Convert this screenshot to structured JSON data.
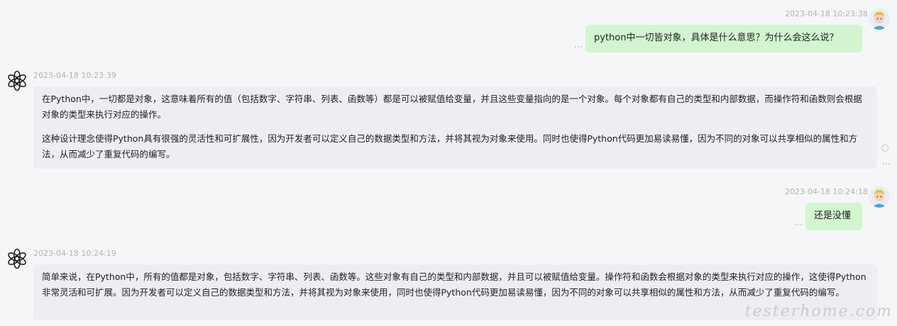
{
  "messages": [
    {
      "role": "user",
      "timestamp": "2023-04-18 10:23:38",
      "text": "python中一切皆对象，具体是什么意思？为什么会这么说？"
    },
    {
      "role": "assistant",
      "timestamp": "2023-04-18 10:23:39",
      "paragraphs": [
        "在Python中，一切都是对象，这意味着所有的值（包括数字、字符串、列表、函数等）都是可以被赋值给变量，并且这些变量指向的是一个对象。每个对象都有自己的类型和内部数据，而操作符和函数则会根据对象的类型来执行对应的操作。",
        "这种设计理念使得Python具有很强的灵活性和可扩展性，因为开发者可以定义自己的数据类型和方法，并将其视为对象来使用。同时也使得Python代码更加易读易懂，因为不同的对象可以共享相似的属性和方法，从而减少了重复代码的编写。"
      ]
    },
    {
      "role": "user",
      "timestamp": "2023-04-18 10:24:18",
      "text": "还是没懂"
    },
    {
      "role": "assistant",
      "timestamp": "2023-04-18 10:24:19",
      "paragraphs": [
        "简单来说，在Python中，所有的值都是对象，包括数字、字符串、列表、函数等。这些对象有自己的类型和内部数据，并且可以被赋值给变量。操作符和函数会根据对象的类型来执行对应的操作，这使得Python非常灵活和可扩展。因为开发者可以定义自己的数据类型和方法，并将其视为对象来使用，同时也使得Python代码更加易读易懂，因为不同的对象可以共享相似的属性和方法，从而减少了重复代码的编写。"
      ]
    }
  ],
  "icons": {
    "user_avatar": "user-avatar-icon",
    "assistant_avatar": "openai-logo-icon",
    "more": "more-vertical-icon",
    "regenerate": "circle-icon"
  },
  "watermark": "testerhome.com",
  "colors": {
    "page_bg": "#f5f6f8",
    "user_bubble": "#d2f5cf",
    "assistant_bubble": "#eceef1",
    "timestamp": "#b3b3b3"
  }
}
